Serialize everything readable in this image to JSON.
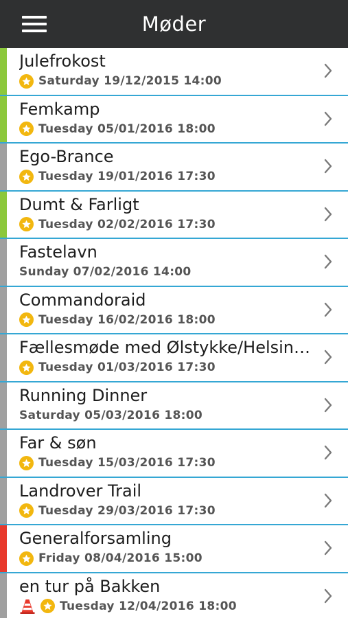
{
  "header": {
    "title": "Møder",
    "menu_icon": "hamburger-menu-icon"
  },
  "colors": {
    "header_bg": "#2f3031",
    "divider": "#35a7d4",
    "star": "#f2b70f",
    "strip_green": "#8cc83c",
    "strip_gray": "#a0a0a0",
    "strip_red": "#e8392c"
  },
  "meetings": [
    {
      "title": "Julefrokost",
      "date": "Saturday 19/12/2015 14:00",
      "star": true,
      "cone": false,
      "strip": "#8cc83c"
    },
    {
      "title": "Femkamp",
      "date": "Tuesday 05/01/2016 18:00",
      "star": true,
      "cone": false,
      "strip": "#8cc83c"
    },
    {
      "title": "Ego-Brance",
      "date": "Tuesday 19/01/2016 17:30",
      "star": true,
      "cone": false,
      "strip": "#a0a0a0"
    },
    {
      "title": "Dumt & Farligt",
      "date": "Tuesday 02/02/2016 17:30",
      "star": true,
      "cone": false,
      "strip": "#8cc83c"
    },
    {
      "title": "Fastelavn",
      "date": "Sunday 07/02/2016 14:00",
      "star": false,
      "cone": false,
      "strip": "#a0a0a0"
    },
    {
      "title": "Commandoraid",
      "date": "Tuesday 16/02/2016 18:00",
      "star": true,
      "cone": false,
      "strip": "#a0a0a0"
    },
    {
      "title": "Fællesmøde med Ølstykke/Helsinge",
      "date": "Tuesday 01/03/2016 17:30",
      "star": true,
      "cone": false,
      "strip": "#a0a0a0"
    },
    {
      "title": "Running Dinner",
      "date": "Saturday 05/03/2016 18:00",
      "star": false,
      "cone": false,
      "strip": "#a0a0a0"
    },
    {
      "title": "Far & søn",
      "date": "Tuesday 15/03/2016 17:30",
      "star": true,
      "cone": false,
      "strip": "#a0a0a0"
    },
    {
      "title": "Landrover Trail",
      "date": "Tuesday 29/03/2016 17:30",
      "star": true,
      "cone": false,
      "strip": "#a0a0a0"
    },
    {
      "title": "Generalforsamling",
      "date": "Friday 08/04/2016 15:00",
      "star": true,
      "cone": false,
      "strip": "#e8392c"
    },
    {
      "title": "en tur på Bakken",
      "date": "Tuesday 12/04/2016 18:00",
      "star": true,
      "cone": true,
      "strip": "#a0a0a0"
    }
  ]
}
